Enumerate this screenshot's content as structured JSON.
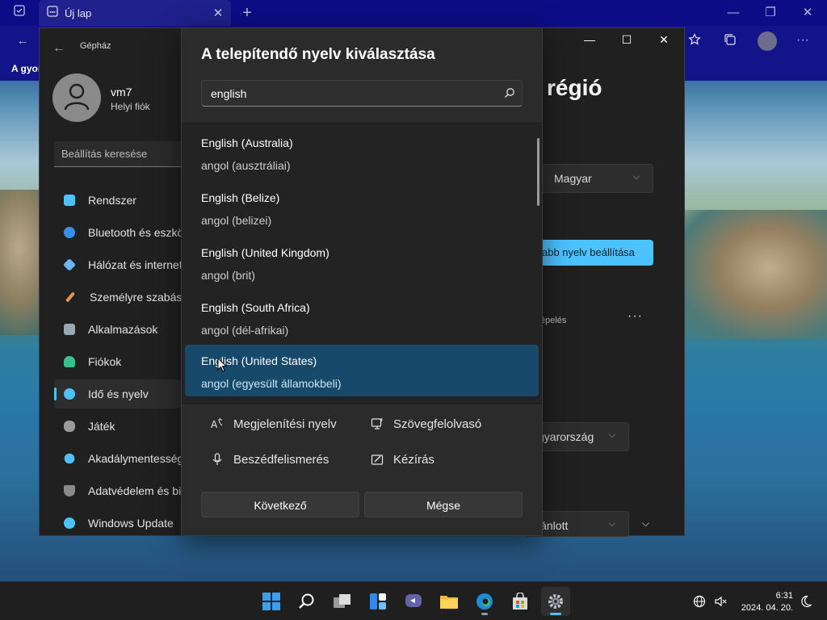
{
  "browser": {
    "tab_title": "Új lap",
    "favorites_label": "A gyor"
  },
  "settings": {
    "app_title": "Gépház",
    "user_name": "vm7",
    "user_account": "Helyi fiók",
    "search_placeholder": "Beállítás keresése",
    "nav_items": [
      {
        "label": "Rendszer",
        "icon": "system-icon",
        "color": "#4cc2ff"
      },
      {
        "label": "Bluetooth és eszközök",
        "icon": "bluetooth-icon",
        "color": "#3a8ef0"
      },
      {
        "label": "Hálózat és internet",
        "icon": "network-icon",
        "color": "#6ab7ff"
      },
      {
        "label": "Személyre szabás",
        "icon": "brush-icon",
        "color": "#e0925b"
      },
      {
        "label": "Alkalmazások",
        "icon": "apps-icon",
        "color": "#9aa7b4"
      },
      {
        "label": "Fiókok",
        "icon": "account-icon",
        "color": "#38c08e"
      },
      {
        "label": "Idő és nyelv",
        "icon": "time-language-icon",
        "color": "#4cc2ff"
      },
      {
        "label": "Játék",
        "icon": "gaming-icon",
        "color": "#9a9a9a"
      },
      {
        "label": "Akadálymentesség",
        "icon": "accessibility-icon",
        "color": "#4cc2ff"
      },
      {
        "label": "Adatvédelem és biztonság",
        "icon": "shield-icon",
        "color": "#8a8a8a"
      },
      {
        "label": "Windows Update",
        "icon": "update-icon",
        "color": "#4cc2ff"
      }
    ],
    "active_nav_index": 6,
    "page_heading": "régió",
    "display_language": "Magyar",
    "add_language_button": "abb nyelv beállítása",
    "typing_text": "épelés",
    "region_value": "gyarország",
    "recommended_value": "jánlott"
  },
  "dialog": {
    "title": "A telepítendő nyelv kiválasztása",
    "search_value": "english",
    "languages": [
      {
        "name": "English (Australia)",
        "local": "angol (ausztráliai)",
        "selected": false
      },
      {
        "name": "English (Belize)",
        "local": "angol (belizei)",
        "selected": false
      },
      {
        "name": "English (United Kingdom)",
        "local": "angol (brit)",
        "selected": false
      },
      {
        "name": "English (South Africa)",
        "local": "angol (dél-afrikai)",
        "selected": false
      },
      {
        "name": "English (United States)",
        "local": "angol (egyesült államokbeli)",
        "selected": true
      }
    ],
    "features": [
      {
        "label": "Megjelenítési nyelv",
        "icon": "display-language-icon"
      },
      {
        "label": "Szövegfelolvasó",
        "icon": "text-to-speech-icon"
      },
      {
        "label": "Beszédfelismerés",
        "icon": "microphone-icon"
      },
      {
        "label": "Kézírás",
        "icon": "handwriting-icon"
      }
    ],
    "next_button": "Következő",
    "cancel_button": "Mégse"
  },
  "taskbar": {
    "time": "6:31",
    "date": "2024. 04. 20.",
    "accent_color": "#4cc2ff"
  }
}
